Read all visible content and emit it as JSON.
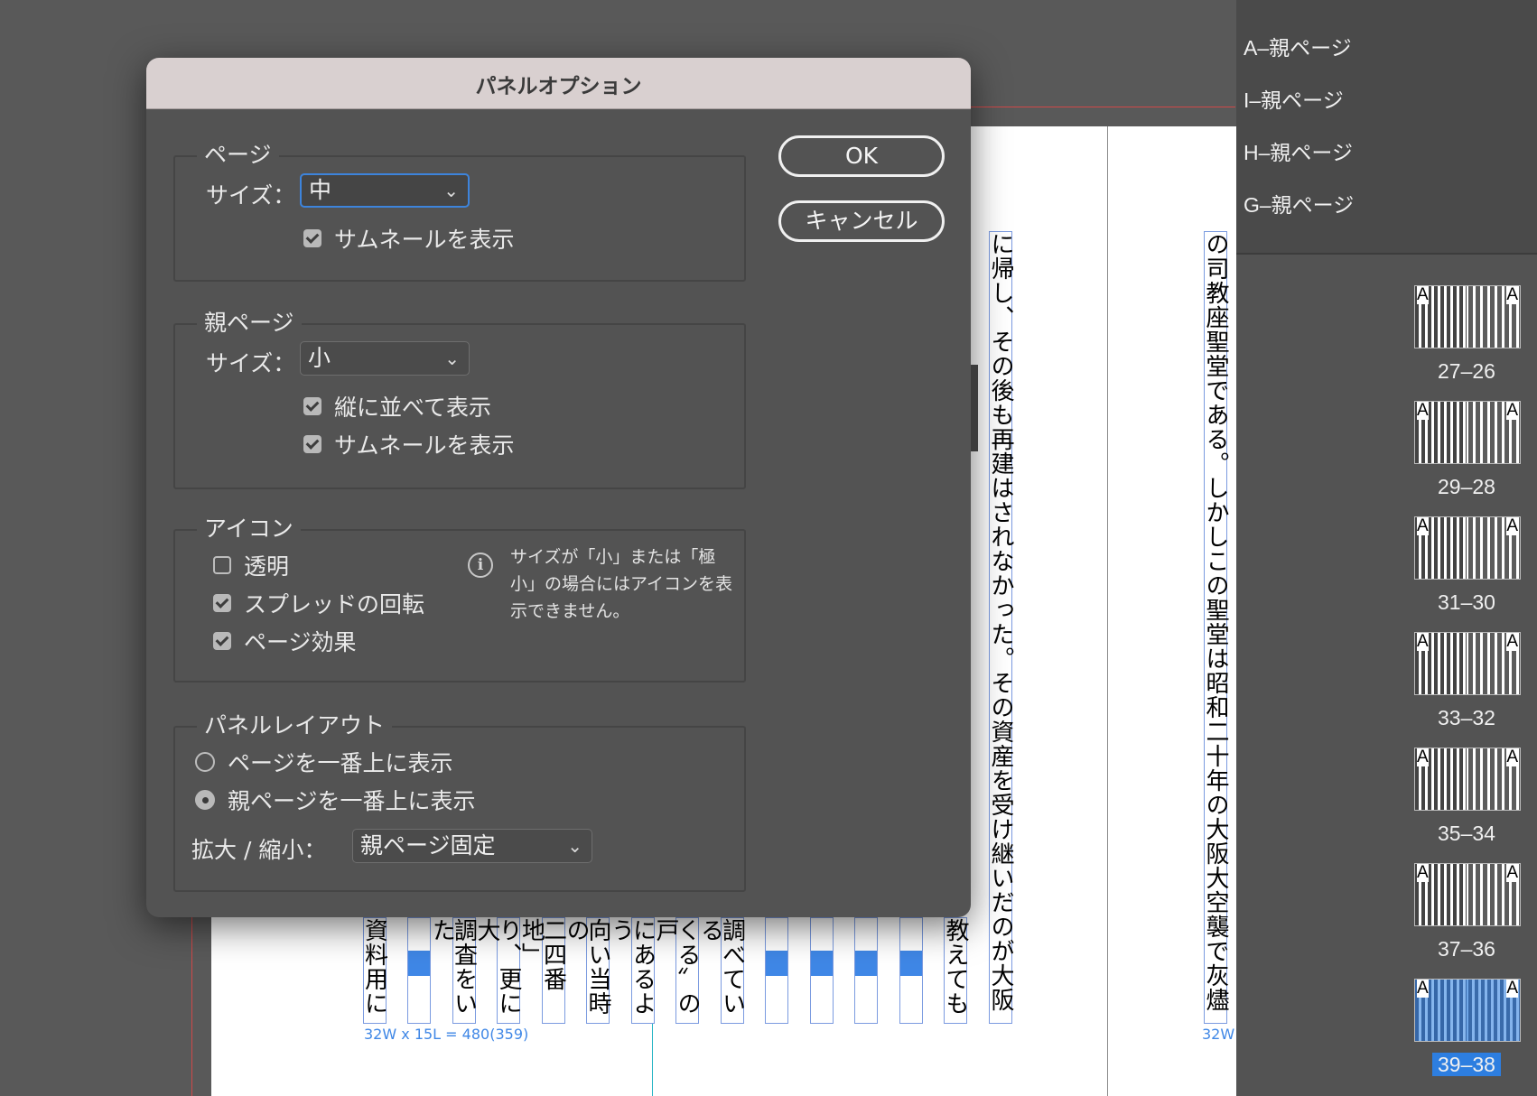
{
  "dialog": {
    "title": "パネルオプション",
    "ok_label": "OK",
    "cancel_label": "キャンセル",
    "page_group": {
      "title": "ページ",
      "size_label": "サイズ：",
      "size_value": "中",
      "show_thumbnails": {
        "label": "サムネールを表示",
        "checked": true
      }
    },
    "parent_group": {
      "title": "親ページ",
      "size_label": "サイズ：",
      "size_value": "小",
      "show_vertically": {
        "label": "縦に並べて表示",
        "checked": true
      },
      "show_thumbnails": {
        "label": "サムネールを表示",
        "checked": true
      }
    },
    "icon_group": {
      "title": "アイコン",
      "transparency": {
        "label": "透明",
        "checked": false
      },
      "spread_rotation": {
        "label": "スプレッドの回転",
        "checked": true
      },
      "page_effects": {
        "label": "ページ効果",
        "checked": true
      },
      "info_text": "サイズが「小」または「極小」の場合にはアイコンを表示できません。"
    },
    "layout_group": {
      "title": "パネルレイアウト",
      "pages_on_top": {
        "label": "ページを一番上に表示",
        "selected": false
      },
      "parents_on_top": {
        "label": "親ページを一番上に表示",
        "selected": true
      },
      "resize_label": "拡大 / 縮小：",
      "resize_value": "親ページ固定"
    }
  },
  "pages_panel": {
    "parent_pages": [
      "A–親ページ",
      "I–親ページ",
      "H–親ページ",
      "G–親ページ"
    ],
    "spreads": [
      {
        "label": "27–26",
        "selected": false
      },
      {
        "label": "29–28",
        "selected": false
      },
      {
        "label": "31–30",
        "selected": false
      },
      {
        "label": "33–32",
        "selected": false
      },
      {
        "label": "35–34",
        "selected": false
      },
      {
        "label": "37–36",
        "selected": false
      },
      {
        "label": "39–38",
        "selected": true
      }
    ],
    "parent_marker": "A"
  },
  "document": {
    "frame_info_left": "32W x 15L = 480(359)",
    "frame_info_right": "32W",
    "column_right_text": "に帰し、その後も再建はされなかった。その資産を受け継いだのが大阪",
    "column_far_right_text": "の司教座聖堂である。しかしこの聖堂は昭和二十年の大阪大空襲で灰燼",
    "bottom_columns": [
      "教えても",
      "",
      "",
      "",
      "",
      "調べている",
      "くる〟の戸",
      "にあるよう",
      "向い当時の",
      "二四番地」",
      "り、更に大",
      "調査をいた",
      "",
      "資料用に"
    ]
  }
}
